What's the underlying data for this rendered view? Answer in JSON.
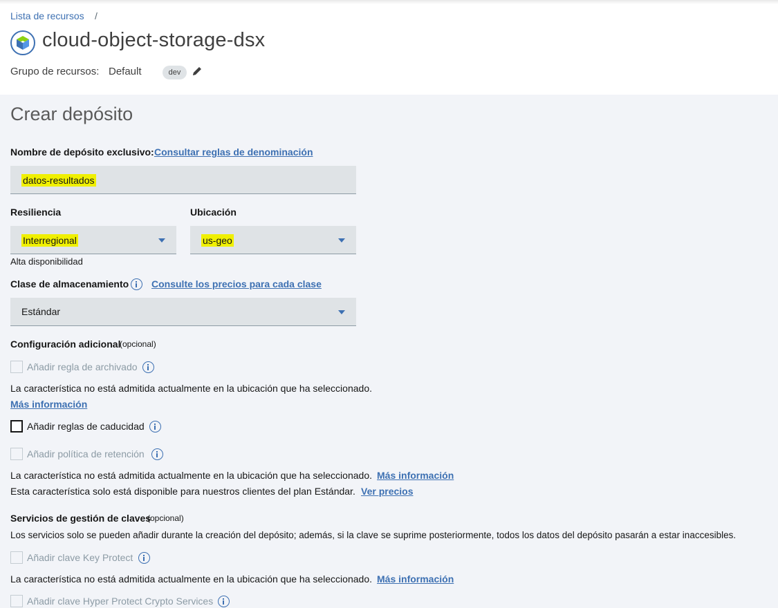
{
  "breadcrumb": {
    "item": "Lista de recursos",
    "separator": "/"
  },
  "service": {
    "title": "cloud-object-storage-dsx",
    "icon": "object-storage-cube-icon"
  },
  "resource_group": {
    "label": "Grupo de recursos:",
    "value": "Default",
    "tag": "dev"
  },
  "form": {
    "heading": "Crear depósito",
    "name": {
      "label": "Nombre de depósito exclusivo:",
      "link": "Consultar reglas de denominación",
      "value": "datos-resultados"
    },
    "resiliency": {
      "label": "Resiliencia",
      "value": "Interregional",
      "helper": "Alta disponibilidad"
    },
    "location": {
      "label": "Ubicación",
      "value": "us-geo"
    },
    "storage_class": {
      "label": "Clase de almacenamiento",
      "link": "Consulte los precios para cada clase",
      "value": "Estándar"
    },
    "additional": {
      "label": "Configuración adicional",
      "optional": "(opcional)",
      "archive": {
        "label": "Añadir regla de archivado",
        "note": "La característica no está admitida actualmente en la ubicación que ha seleccionado.",
        "link": "Más información"
      },
      "expiration": {
        "label": "Añadir reglas de caducidad"
      },
      "retention": {
        "label": "Añadir política de retención",
        "note": "La característica no está admitida actualmente en la ubicación que ha seleccionado.",
        "link": "Más información",
        "plan_note": "Esta característica solo está disponible para nuestros clientes del plan Estándar.",
        "plan_link": "Ver precios"
      }
    },
    "key_management": {
      "label": "Servicios de gestión de claves",
      "optional": "(opcional)",
      "description": "Los servicios solo se pueden añadir durante la creación del depósito; además, si la clave se suprime posteriormente, todos los datos del depósito pasarán a estar inaccesibles.",
      "key_protect": {
        "label": "Añadir clave Key Protect",
        "note": "La característica no está admitida actualmente en la ubicación que ha seleccionado.",
        "link": "Más información"
      },
      "hyper_protect": {
        "label": "Añadir clave Hyper Protect Crypto Services"
      }
    }
  },
  "colors": {
    "link": "#3d70b2",
    "highlight": "#f0f000",
    "field_bg": "#dfe3e6"
  }
}
